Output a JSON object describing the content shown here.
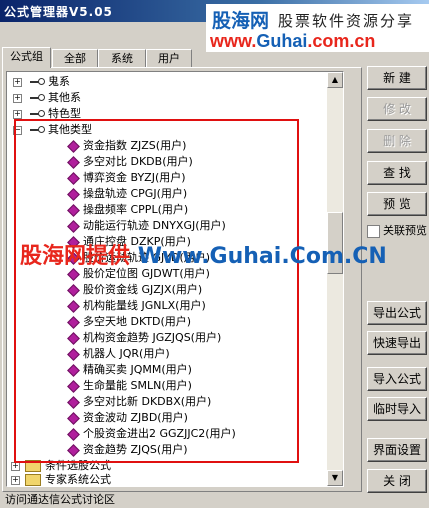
{
  "window": {
    "title": "公式管理器V5.05"
  },
  "watermark": {
    "logo": "股海网",
    "subtitle": "股票软件资源分享",
    "url_prefix": "www.",
    "url_brand": "Guhai",
    "url_suffix": ".com.cn",
    "overlay_left": "股海网提供",
    "overlay_right": "Www.Guhai.Com.CN"
  },
  "tabs": [
    {
      "label": "公式组"
    },
    {
      "label": "全部"
    },
    {
      "label": "系统"
    },
    {
      "label": "用户"
    }
  ],
  "tree": {
    "top_items": [
      {
        "label": "鬼系"
      },
      {
        "label": "其他系"
      },
      {
        "label": "特色型"
      }
    ],
    "expanded_group": {
      "label": "其他类型"
    },
    "formulas": [
      {
        "label": "资金指数  ZJZS(用户)"
      },
      {
        "label": "多空对比  DKDB(用户)"
      },
      {
        "label": "博弈资金  BYZJ(用户)"
      },
      {
        "label": "操盘轨迹  CPGJ(用户)"
      },
      {
        "label": "操盘频率  CPPL(用户)"
      },
      {
        "label": "动能运行轨迹  DNYXGJ(用户)"
      },
      {
        "label": "通庄控盘  DZKP(用户)"
      },
      {
        "label": "股价运动轨迹  GJYD(用户)"
      },
      {
        "label": "股价定位图  GJDWT(用户)"
      },
      {
        "label": "股价资金线  GJZJX(用户)"
      },
      {
        "label": "机构能量线  JGNLX(用户)"
      },
      {
        "label": "多空天地  DKTD(用户)"
      },
      {
        "label": "机构资金趋势  JGZJQS(用户)"
      },
      {
        "label": "机器人  JQR(用户)"
      },
      {
        "label": "精确买卖  JQMM(用户)"
      },
      {
        "label": "生命量能  SMLN(用户)"
      },
      {
        "label": "多空对比新  DKDBX(用户)"
      },
      {
        "label": "资金波动  ZJBD(用户)"
      },
      {
        "label": "个股资金进出2  GGZJJC2(用户)"
      },
      {
        "label": "资金趋势  ZJQS(用户)"
      }
    ],
    "bottom_groups": [
      {
        "label": "条件选股公式"
      },
      {
        "label": "专家系统公式"
      }
    ]
  },
  "buttons": {
    "new": "新 建",
    "edit": "修 改",
    "delete": "删 除",
    "find": "查 找",
    "preview": "预 览",
    "export_formula": "导出公式",
    "quick_export": "快速导出",
    "import_formula": "导入公式",
    "temp_import": "临时导入",
    "ui_settings": "界面设置",
    "close": "关 闭"
  },
  "checkbox": {
    "label": "关联预览",
    "checked": false
  },
  "status": {
    "text": "访问通达信公式讨论区"
  },
  "colors": {
    "highlight_box": "#e01010",
    "formula_icon": "#b01f9c",
    "title_bar": "#0a246a"
  }
}
